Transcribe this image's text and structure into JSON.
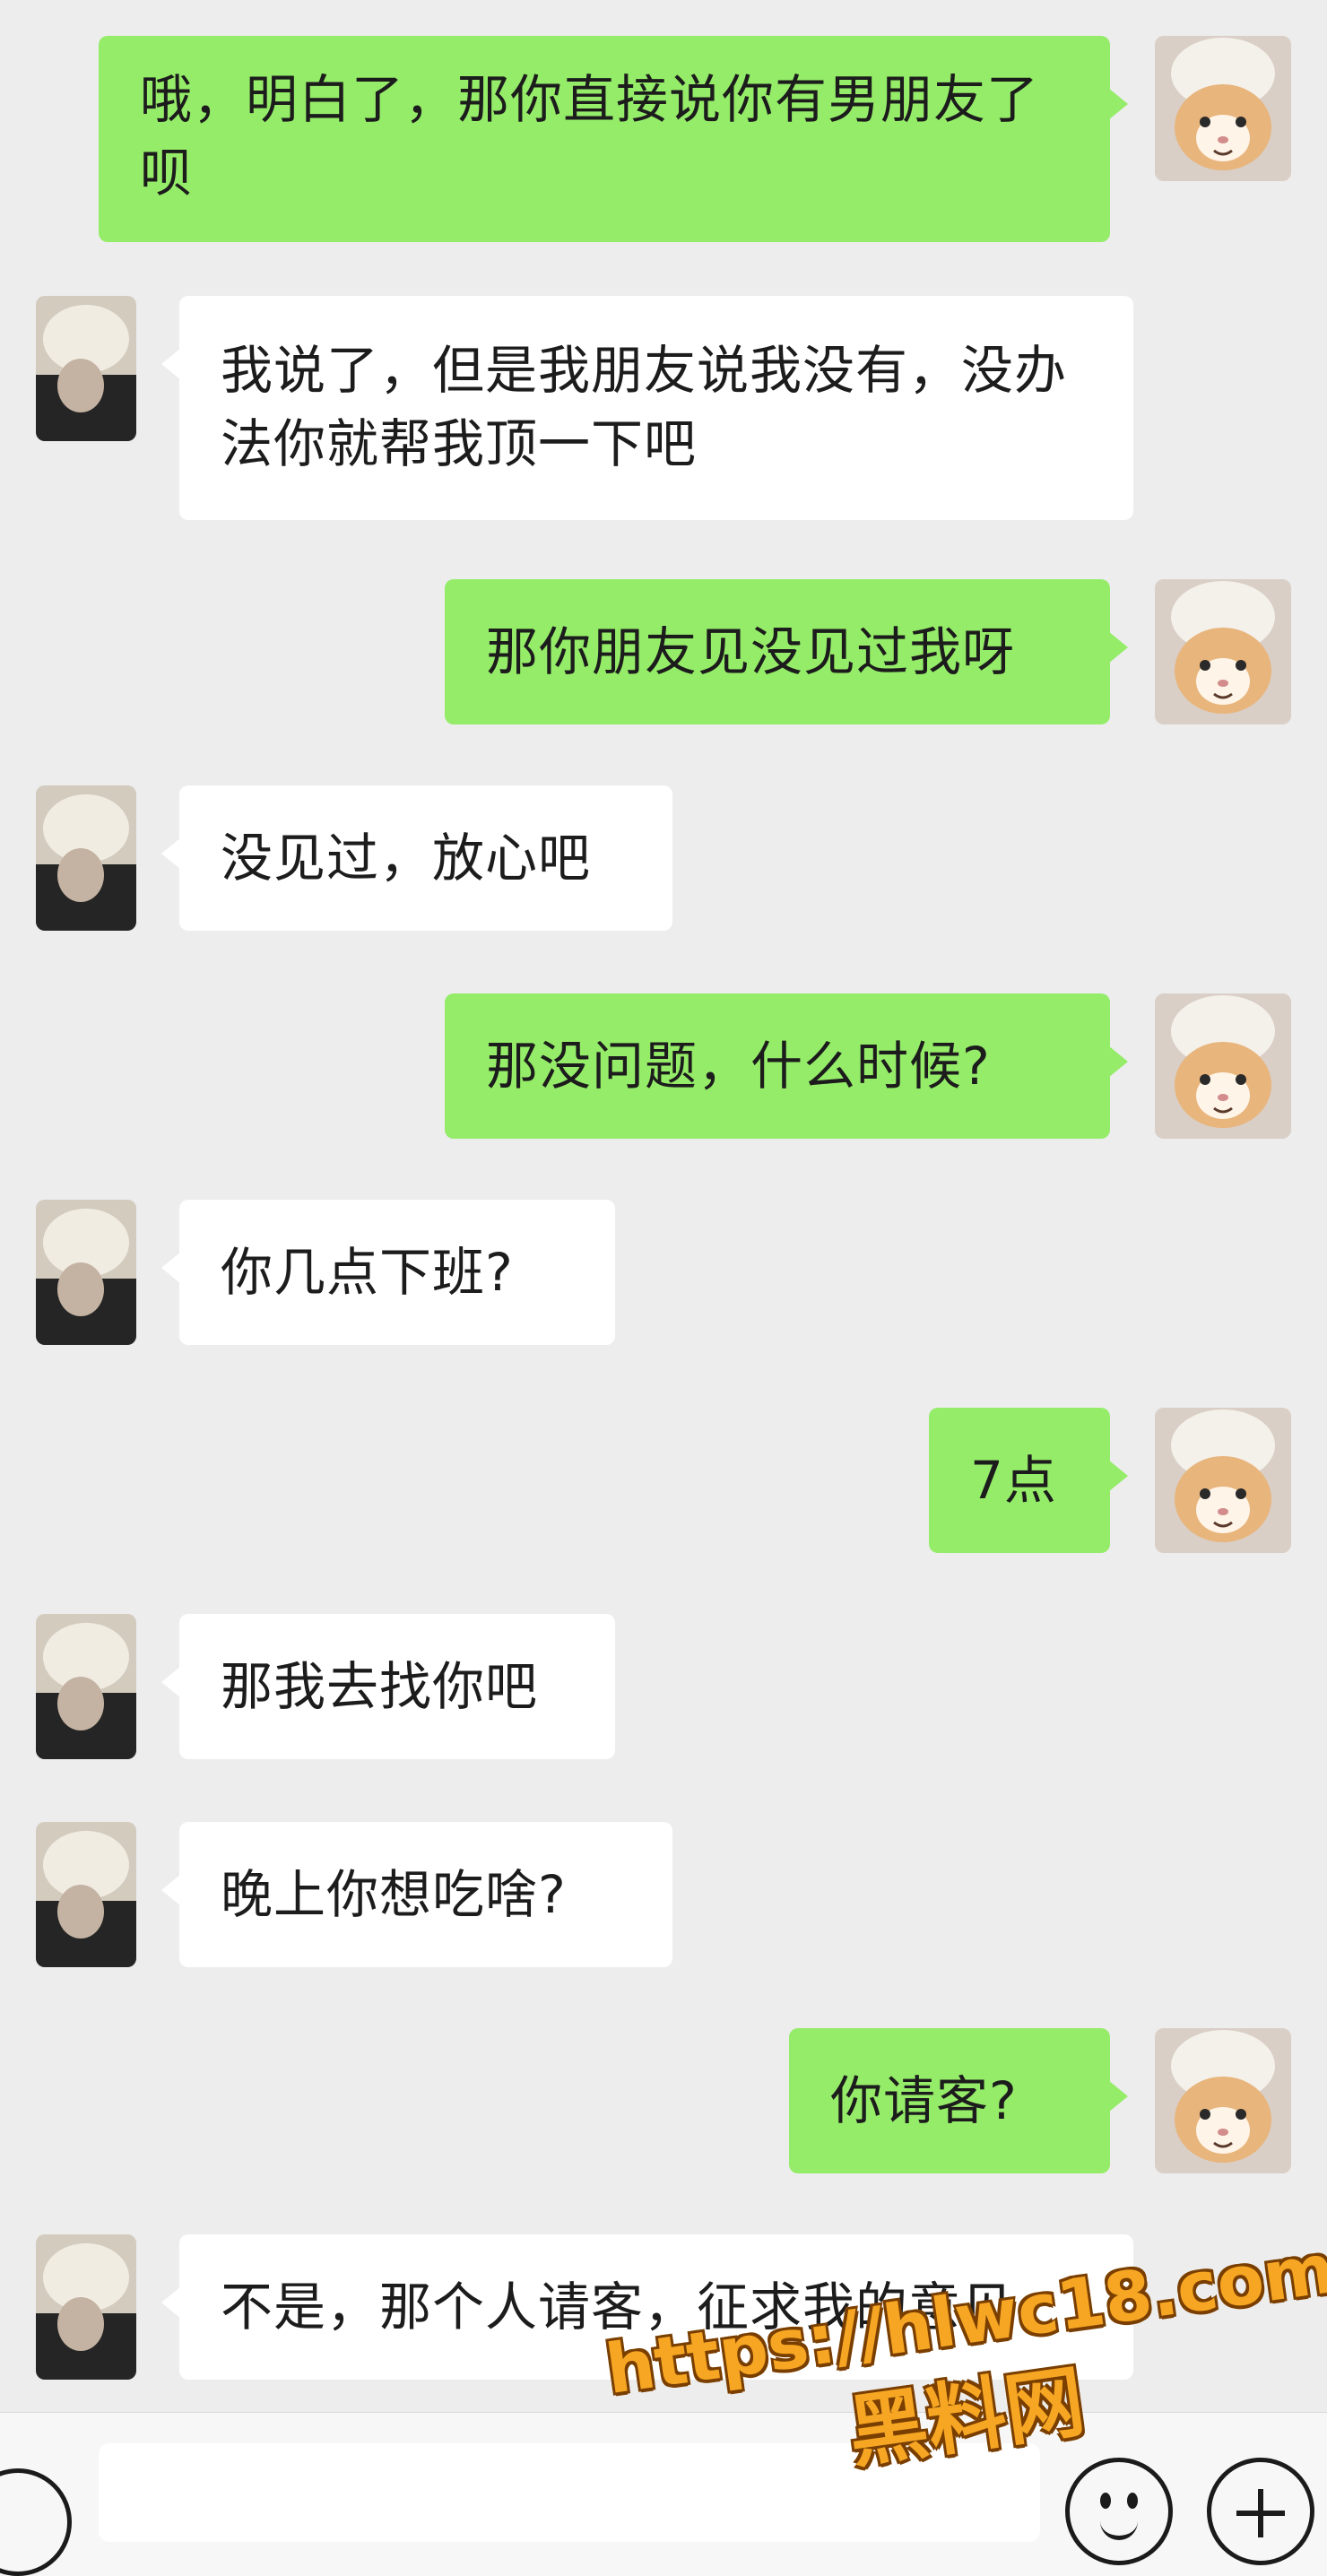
{
  "messages": [
    {
      "side": "right",
      "text": "哦，明白了，那你直接说你有男朋友了呗"
    },
    {
      "side": "left",
      "text": "我说了，但是我朋友说我没有，没办法你就帮我顶一下吧"
    },
    {
      "side": "right",
      "text": "那你朋友见没见过我呀"
    },
    {
      "side": "left",
      "text": "没见过，放心吧"
    },
    {
      "side": "right",
      "text": "那没问题，什么时候?"
    },
    {
      "side": "left",
      "text": "你几点下班?"
    },
    {
      "side": "right",
      "text": "7点"
    },
    {
      "side": "left",
      "text": "那我去找你吧"
    },
    {
      "side": "left",
      "text": "晚上你想吃啥?"
    },
    {
      "side": "right",
      "text": "你请客?"
    },
    {
      "side": "left",
      "text": "不是，那个人请客，征求我的意见"
    }
  ],
  "watermark": {
    "url": "https://hlwc18.com",
    "name": "黑料网"
  },
  "colors": {
    "background": "#ededed",
    "bubble_self": "#95ec69",
    "bubble_other": "#ffffff",
    "watermark": "#f6a623"
  },
  "icons": {
    "voice": "voice-icon",
    "emoji": "emoji-icon",
    "plus": "plus-icon"
  }
}
